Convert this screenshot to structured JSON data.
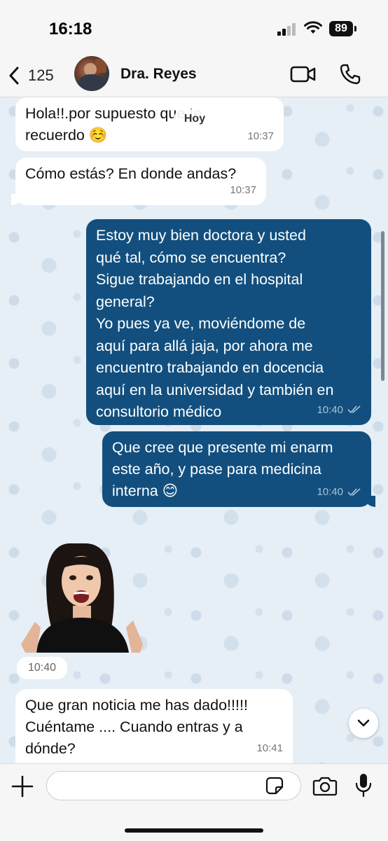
{
  "status_bar": {
    "time": "16:18",
    "battery": "89"
  },
  "header": {
    "back_count": "125",
    "contact_name": "Dra. Reyes"
  },
  "date_separator": "Hoy",
  "messages": [
    {
      "direction": "in",
      "text": "Hola!!.por supuesto que te\nrecuerdo ☺️",
      "time": "10:37"
    },
    {
      "direction": "in",
      "text": "Cómo estás? En donde andas?",
      "time": "10:37"
    },
    {
      "direction": "out",
      "text": "Estoy muy bien doctora y usted\nqué tal, cómo se encuentra?\nSigue trabajando en el hospital\ngeneral?\nYo pues ya ve, moviéndome de\naquí para allá jaja, por ahora me\nencuentro trabajando en docencia\naquí en la universidad y también en\nconsultorio médico",
      "time": "10:40",
      "status": "read"
    },
    {
      "direction": "out",
      "text": "Que cree que presente mi enarm\neste año, y pase para medicina\ninterna 😊",
      "time": "10:40",
      "status": "read"
    },
    {
      "direction": "in",
      "type": "sticker",
      "time": "10:40"
    },
    {
      "direction": "in",
      "text": "Que gran noticia me has dado!!!!!\nCuéntame .... Cuando entras y a\ndónde?",
      "time": "10:41"
    }
  ],
  "composer": {
    "placeholder": ""
  },
  "colors": {
    "outgoing_bubble": "#124f7e",
    "incoming_bubble": "#ffffff",
    "chat_background": "#e6eef6"
  }
}
